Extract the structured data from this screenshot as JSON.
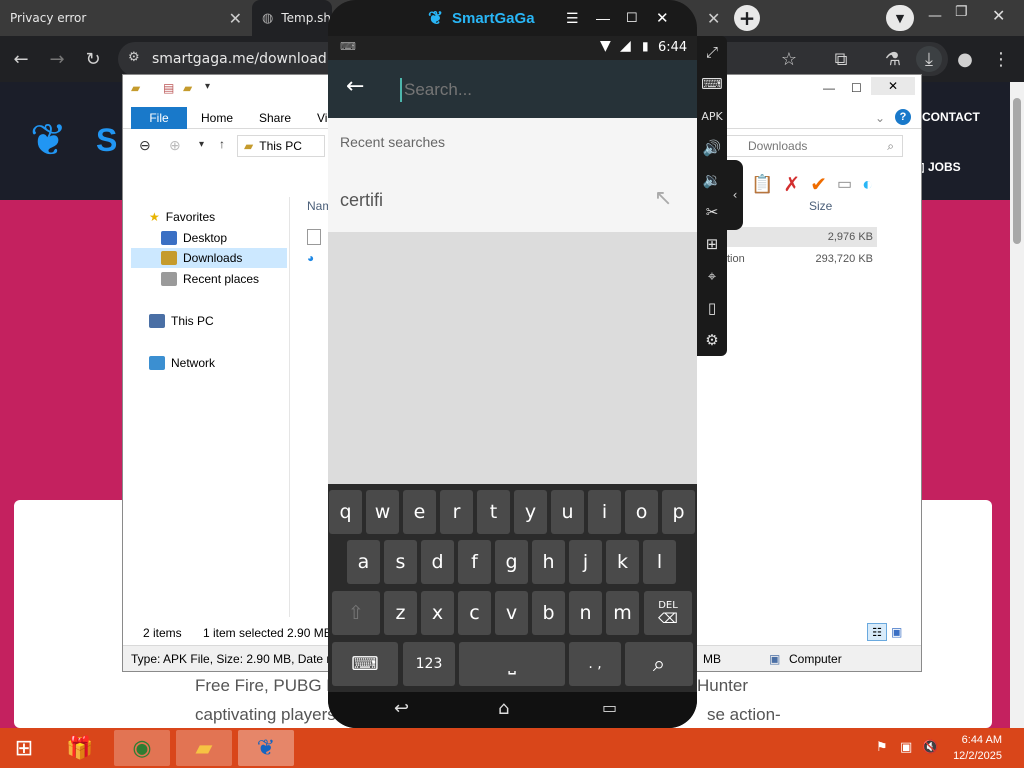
{
  "browser": {
    "tabs": [
      {
        "title": "Privacy error"
      },
      {
        "title": "Temp.sh"
      }
    ],
    "url": "smartgaga.me/downloading"
  },
  "website": {
    "nav": [
      "CONTACT",
      "JOBS"
    ],
    "body_lines": [
      "Free Fire, PUBG M",
      "captivating players",
      "Hunter",
      "se action-"
    ]
  },
  "explorer": {
    "ribbon": {
      "file": "File",
      "home": "Home",
      "share": "Share",
      "view": "Vi"
    },
    "breadcrumb": "This PC",
    "search_placeholder": "Downloads",
    "nav": {
      "favorites": "Favorites",
      "desktop": "Desktop",
      "downloads": "Downloads",
      "recent": "Recent places",
      "thispc": "This PC",
      "network": "Network"
    },
    "columns": {
      "name": "Nam",
      "size": "Size"
    },
    "rows": [
      {
        "type": "",
        "size": "2,976 KB"
      },
      {
        "type": "tion",
        "size": "293,720 KB"
      }
    ],
    "status": {
      "items": "2 items",
      "selected": "1 item selected  2.90 MB"
    },
    "detail": {
      "left": "Type: APK File, Size: 2.90 MB, Date m",
      "size": "MB",
      "location": "Computer"
    }
  },
  "emulator": {
    "title": "SmartGaGa",
    "time": "6:44",
    "search_placeholder": "Search...",
    "recent_header": "Recent searches",
    "recent_items": [
      "certifi"
    ],
    "keyboard": {
      "row1": [
        "q",
        "w",
        "e",
        "r",
        "t",
        "y",
        "u",
        "i",
        "o",
        "p"
      ],
      "row2": [
        "a",
        "s",
        "d",
        "f",
        "g",
        "h",
        "j",
        "k",
        "l"
      ],
      "row3": [
        "z",
        "x",
        "c",
        "v",
        "b",
        "n",
        "m"
      ],
      "del": "DEL",
      "num": "123",
      "punct": ". ,"
    }
  },
  "taskbar": {
    "time": "6:44 AM",
    "date": "12/2/2025"
  },
  "colors": {
    "site_pink": "#c4215f",
    "taskbar": "#d9461a",
    "appbar": "#263238",
    "accent": "#1979ca"
  }
}
